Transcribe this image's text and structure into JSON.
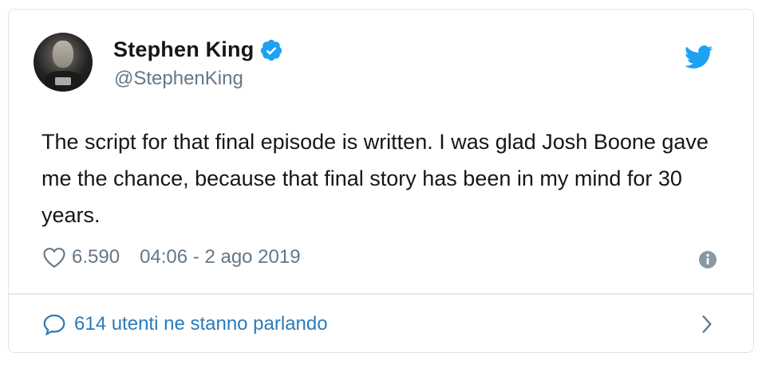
{
  "author": {
    "display_name": "Stephen King",
    "handle": "@StephenKing",
    "verified": true
  },
  "tweet": {
    "text": "The script for that final episode is written. I was glad Josh Boone gave me the chance, because that final story has been in my mind for 30 years."
  },
  "meta": {
    "likes": "6.590",
    "timestamp": "04:06 - 2 ago 2019"
  },
  "footer": {
    "conversation_label": "614 utenti ne stanno parlando"
  },
  "icons": {
    "verified": "verified-badge-icon",
    "brand": "twitter-bird-icon",
    "like": "heart-icon",
    "info": "info-icon",
    "reply": "speech-bubble-icon",
    "chevron": "chevron-right-icon"
  },
  "colors": {
    "twitter_blue": "#1da1f2",
    "link_blue": "#2b7bb9",
    "text_primary": "#14171a",
    "text_secondary": "#657786",
    "border": "#dfe4e8"
  }
}
